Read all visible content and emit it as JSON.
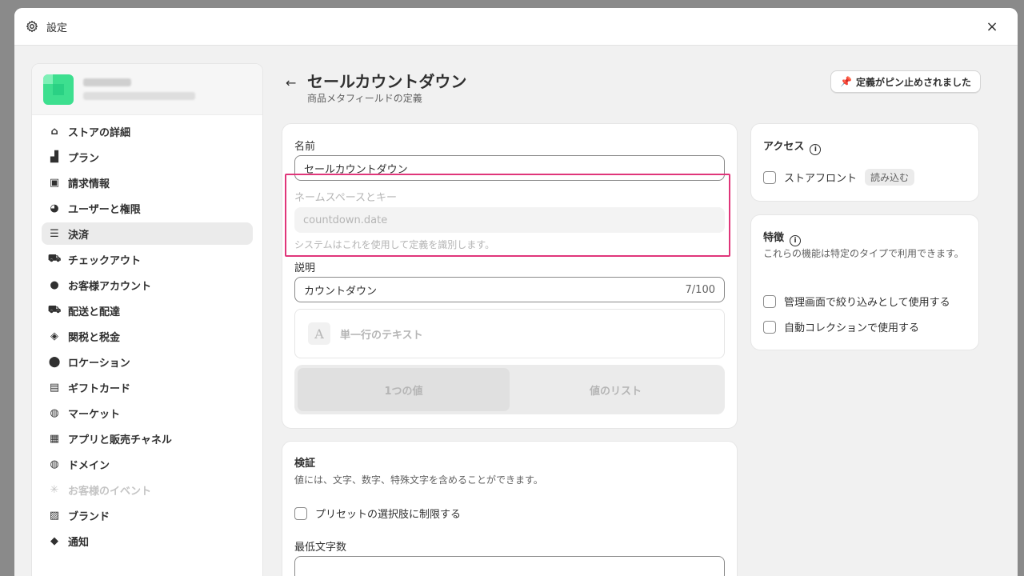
{
  "window": {
    "title": "設定",
    "close_symbol": "×"
  },
  "sidebar": {
    "items": [
      {
        "label": "ストアの詳細",
        "icon": "store-icon",
        "glyph": "⌂"
      },
      {
        "label": "プラン",
        "icon": "plan-chart-icon",
        "glyph": "▟"
      },
      {
        "label": "請求情報",
        "icon": "billing-icon",
        "glyph": "▣"
      },
      {
        "label": "ユーザーと権限",
        "icon": "user-permissions-icon",
        "glyph": "◕"
      },
      {
        "label": "決済",
        "icon": "payments-icon",
        "glyph": "☰"
      },
      {
        "label": "チェックアウト",
        "icon": "cart-icon",
        "glyph": "⛟"
      },
      {
        "label": "お客様アカウント",
        "icon": "person-icon",
        "glyph": "●"
      },
      {
        "label": "配送と配達",
        "icon": "truck-icon",
        "glyph": "⛟"
      },
      {
        "label": "関税と税金",
        "icon": "tax-bag-icon",
        "glyph": "◈"
      },
      {
        "label": "ロケーション",
        "icon": "location-pin-icon",
        "glyph": "⬤"
      },
      {
        "label": "ギフトカード",
        "icon": "gift-card-icon",
        "glyph": "▤"
      },
      {
        "label": "マーケット",
        "icon": "globe-icon",
        "glyph": "◍"
      },
      {
        "label": "アプリと販売チャネル",
        "icon": "apps-icon",
        "glyph": "▦"
      },
      {
        "label": "ドメイン",
        "icon": "domain-globe-icon",
        "glyph": "◍"
      },
      {
        "label": "お客様のイベント",
        "icon": "cursor-click-icon",
        "glyph": "✳"
      },
      {
        "label": "ブランド",
        "icon": "brand-image-icon",
        "glyph": "▨"
      },
      {
        "label": "通知",
        "icon": "bell-icon",
        "glyph": "◆"
      }
    ],
    "active_index": 4,
    "disabled_index": 14
  },
  "header": {
    "back_symbol": "←",
    "title": "セールカウントダウン",
    "subtitle": "商品メタフィールドの定義",
    "pin_button": "定義がピン止めされました"
  },
  "definition": {
    "name_label": "名前",
    "name_value": "セールカウントダウン",
    "namespace_label": "ネームスペースとキー",
    "namespace_value": "countdown.date",
    "namespace_hint": "システムはこれを使用して定義を識別します。",
    "description_label": "説明",
    "description_value": "カウントダウン",
    "description_count": "7/100",
    "type_icon_letter": "A",
    "type_label": "単一行のテキスト",
    "segment_single": "1つの値",
    "segment_list": "値のリスト"
  },
  "validation": {
    "title": "検証",
    "description": "値には、文字、数字、特殊文字を含めることができます。",
    "preset_checkbox": "プリセットの選択肢に制限する",
    "min_chars_label": "最低文字数"
  },
  "access": {
    "title": "アクセス",
    "storefront_label": "ストアフロント",
    "storefront_badge": "読み込む"
  },
  "features": {
    "title": "特徴",
    "description": "これらの機能は特定のタイプで利用できます。",
    "filter_label": "管理画面で絞り込みとして使用する",
    "collection_label": "自動コレクションで使用する"
  },
  "colors": {
    "highlight": "#e0367a"
  }
}
